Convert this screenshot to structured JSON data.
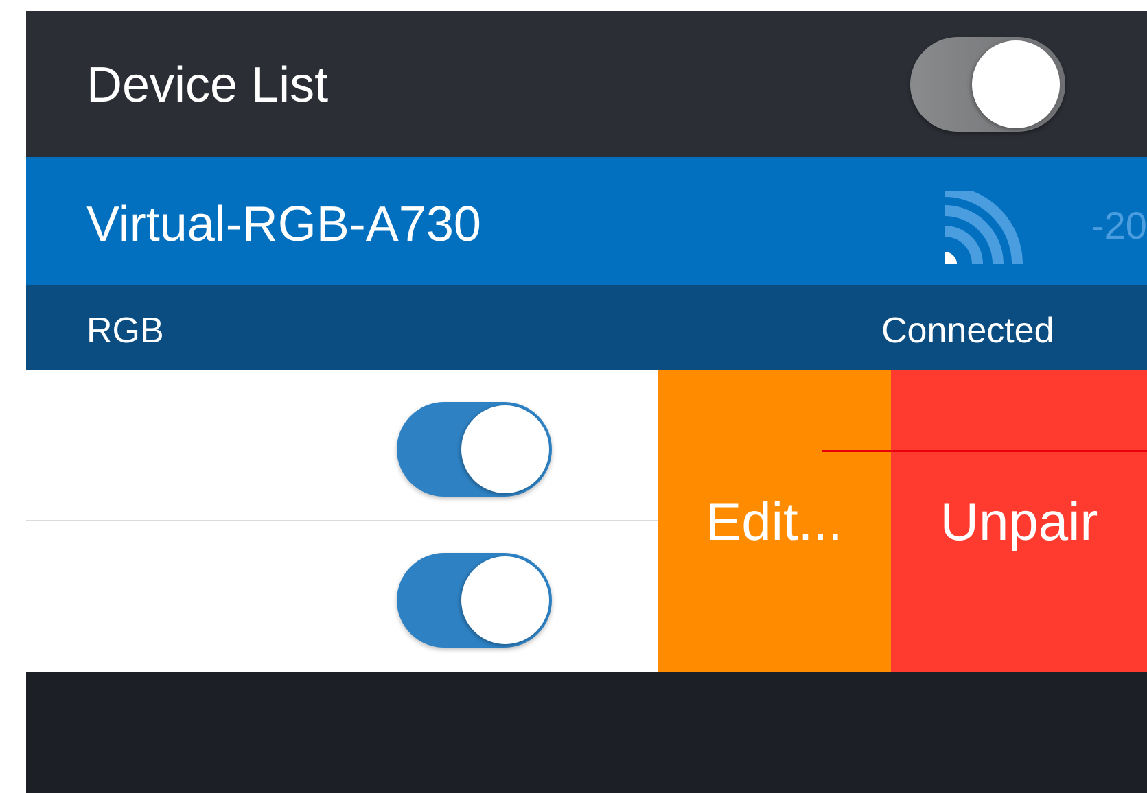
{
  "header": {
    "title": "Device List",
    "master_toggle": {
      "on": true
    }
  },
  "device": {
    "name": "Virtual-RGB-A730",
    "signal_icon": "wifi-signal-icon",
    "rssi": "-20",
    "type": "RGB",
    "status": "Connected"
  },
  "channels": [
    {
      "on": true
    },
    {
      "on": true
    }
  ],
  "actions": {
    "edit_label": "Edit...",
    "unpair_label": "Unpair"
  },
  "colors": {
    "header_bg": "#2b2e35",
    "device_row_bg": "#0270bf",
    "sub_row_bg": "#0b4d80",
    "toggle_on": "#2e82c4",
    "edit_bg": "#ff8c00",
    "unpair_bg": "#ff3b30",
    "footer_bg": "#1c1f26"
  }
}
